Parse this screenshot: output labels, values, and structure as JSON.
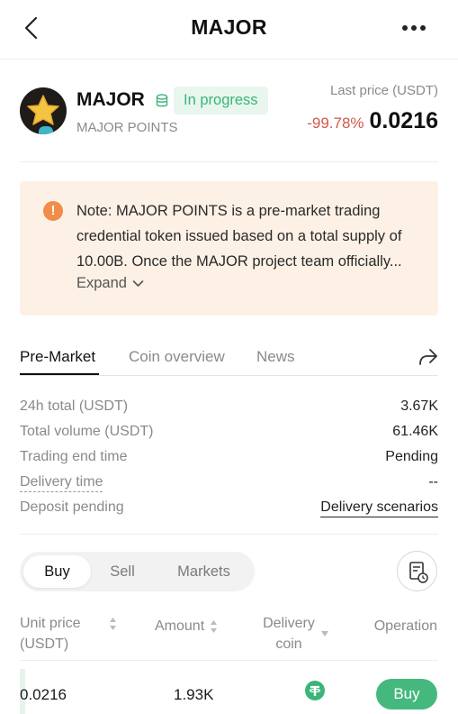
{
  "header": {
    "title": "MAJOR",
    "back_icon": "chevron-left-icon",
    "more_icon": "more-dots-icon"
  },
  "token": {
    "name": "MAJOR",
    "subtitle": "MAJOR POINTS",
    "status": "In progress",
    "last_price_label": "Last price (USDT)",
    "price_change": "-99.78%",
    "last_price": "0.0216"
  },
  "note": {
    "text": "Note: MAJOR POINTS is a pre-market trading credential token issued based on a total supply of 10.00B. Once the MAJOR project team officially...",
    "expand_label": "Expand"
  },
  "tabs": [
    {
      "label": "Pre-Market",
      "active": true
    },
    {
      "label": "Coin overview",
      "active": false
    },
    {
      "label": "News",
      "active": false
    }
  ],
  "stats": [
    {
      "label": "24h total (USDT)",
      "value": "3.67K"
    },
    {
      "label": "Total volume (USDT)",
      "value": "61.46K"
    },
    {
      "label": "Trading end time",
      "value": "Pending"
    },
    {
      "label": "Delivery time",
      "value": "--"
    },
    {
      "label": "Deposit pending",
      "value": "Delivery scenarios"
    }
  ],
  "trade_tabs": [
    {
      "label": "Buy",
      "active": true
    },
    {
      "label": "Sell",
      "active": false
    },
    {
      "label": "Markets",
      "active": false
    }
  ],
  "table": {
    "columns": [
      "Unit price (USDT)",
      "Amount",
      "Delivery coin",
      "Operation"
    ],
    "rows": [
      {
        "unit_price": "0.0216",
        "amount": "1.93K",
        "delivery_coin_icon": "tether-usdt-icon",
        "action": "Buy"
      }
    ]
  },
  "colors": {
    "accent_green": "#45b97d",
    "negative_red": "#d2584a",
    "note_bg": "#fdf1e6",
    "warn_orange": "#ef8d4a"
  }
}
